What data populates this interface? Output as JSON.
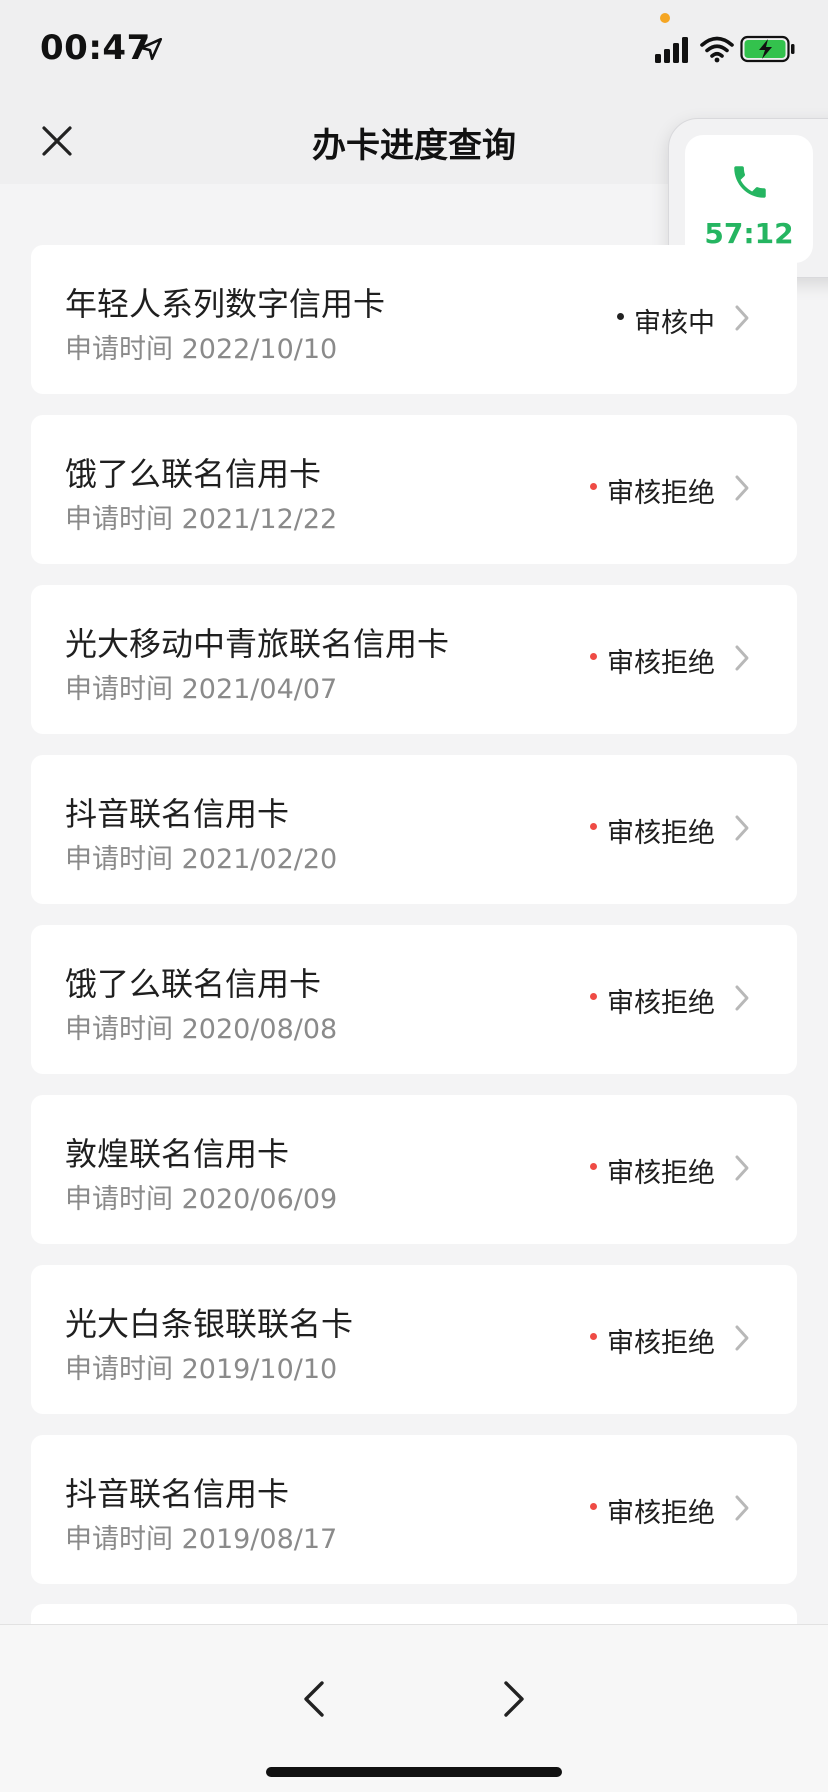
{
  "status_bar": {
    "time": "00:47",
    "icons": [
      "location-arrow-icon",
      "signal-icon",
      "wifi-icon",
      "battery-charging-icon"
    ]
  },
  "nav": {
    "title": "办卡进度查询",
    "close_icon": "close-icon"
  },
  "call_widget": {
    "timer": "57:12",
    "icon": "phone-icon",
    "accent": "#25b561"
  },
  "colors": {
    "reviewing_dot": "#222222",
    "rejected_dot": "#ef4b45"
  },
  "applications": [
    {
      "name": "年轻人系列数字信用卡",
      "date": "申请时间 2022/10/10",
      "status": "审核中",
      "status_type": "reviewing"
    },
    {
      "name": "饿了么联名信用卡",
      "date": "申请时间 2021/12/22",
      "status": "审核拒绝",
      "status_type": "rejected"
    },
    {
      "name": "光大移动中青旅联名信用卡",
      "date": "申请时间 2021/04/07",
      "status": "审核拒绝",
      "status_type": "rejected"
    },
    {
      "name": "抖音联名信用卡",
      "date": "申请时间 2021/02/20",
      "status": "审核拒绝",
      "status_type": "rejected"
    },
    {
      "name": "饿了么联名信用卡",
      "date": "申请时间 2020/08/08",
      "status": "审核拒绝",
      "status_type": "rejected"
    },
    {
      "name": "敦煌联名信用卡",
      "date": "申请时间 2020/06/09",
      "status": "审核拒绝",
      "status_type": "rejected"
    },
    {
      "name": "光大白条银联联名卡",
      "date": "申请时间 2019/10/10",
      "status": "审核拒绝",
      "status_type": "rejected"
    },
    {
      "name": "抖音联名信用卡",
      "date": "申请时间 2019/08/17",
      "status": "审核拒绝",
      "status_type": "rejected"
    }
  ],
  "bottom_bar": {
    "back_icon": "chevron-left-icon",
    "forward_icon": "chevron-right-icon"
  }
}
